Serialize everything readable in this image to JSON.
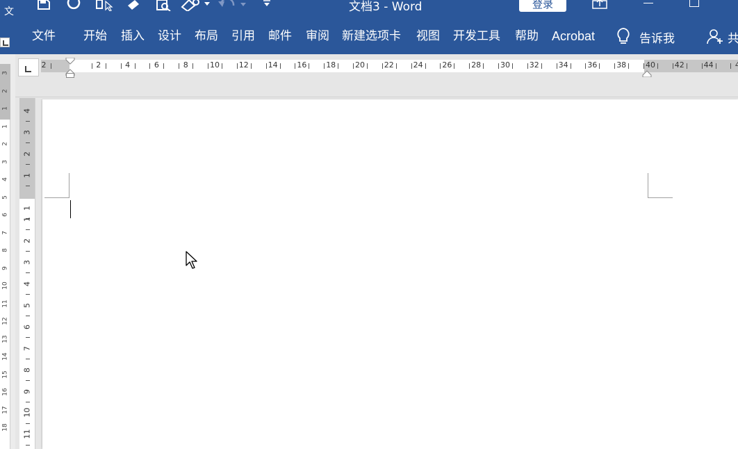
{
  "app": {
    "document_title": "文档3  -  Word",
    "login_label": "登录"
  },
  "ribbon": {
    "tabs": [
      {
        "id": "file",
        "label": "文件"
      },
      {
        "id": "home",
        "label": "开始"
      },
      {
        "id": "insert",
        "label": "插入"
      },
      {
        "id": "design",
        "label": "设计"
      },
      {
        "id": "layout",
        "label": "布局"
      },
      {
        "id": "references",
        "label": "引用"
      },
      {
        "id": "mailings",
        "label": "邮件"
      },
      {
        "id": "review",
        "label": "审阅"
      },
      {
        "id": "newtab",
        "label": "新建选项卡"
      },
      {
        "id": "view",
        "label": "视图"
      },
      {
        "id": "developer",
        "label": "开发工具"
      },
      {
        "id": "help",
        "label": "帮助"
      },
      {
        "id": "acrobat",
        "label": "Acrobat"
      }
    ],
    "tell_me_label": "告诉我",
    "share_label": "共"
  },
  "ruler": {
    "h_labels": [
      "2",
      "2",
      "4",
      "6",
      "8",
      "10",
      "12",
      "14",
      "16",
      "18",
      "20",
      "22",
      "24",
      "26",
      "28",
      "30",
      "32",
      "34",
      "36",
      "38",
      "40",
      "42",
      "44",
      "4"
    ],
    "v_labels": [
      "4",
      "3",
      "2",
      "1",
      "1",
      "1",
      "2",
      "3",
      "4",
      "5",
      "6",
      "7",
      "8",
      "9",
      "10",
      "11"
    ]
  },
  "behind_window": {
    "title_char": "文",
    "v_ruler_labels": [
      "3",
      "2",
      "1",
      "1",
      "2",
      "3",
      "4",
      "5",
      "6",
      "7",
      "8",
      "9",
      "10",
      "11",
      "12",
      "13",
      "14",
      "15",
      "16",
      "17",
      "18"
    ]
  },
  "icons": {
    "quick_access": [
      "save-icon",
      "autosave-icon",
      "touch-mode-icon",
      "format-painter-icon",
      "print-preview-icon",
      "shapes-icon",
      "undo-icon",
      "customize-qat-icon"
    ],
    "window": [
      "ribbon-display-icon",
      "minimize-icon",
      "restore-icon"
    ],
    "ribbon": [
      "lightbulb-icon",
      "share-user-icon"
    ]
  },
  "colors": {
    "ribbon_blue": "#2b579a",
    "ruler_margin_gray": "#c6c6c6",
    "workspace_gray": "#e6e6e6"
  }
}
